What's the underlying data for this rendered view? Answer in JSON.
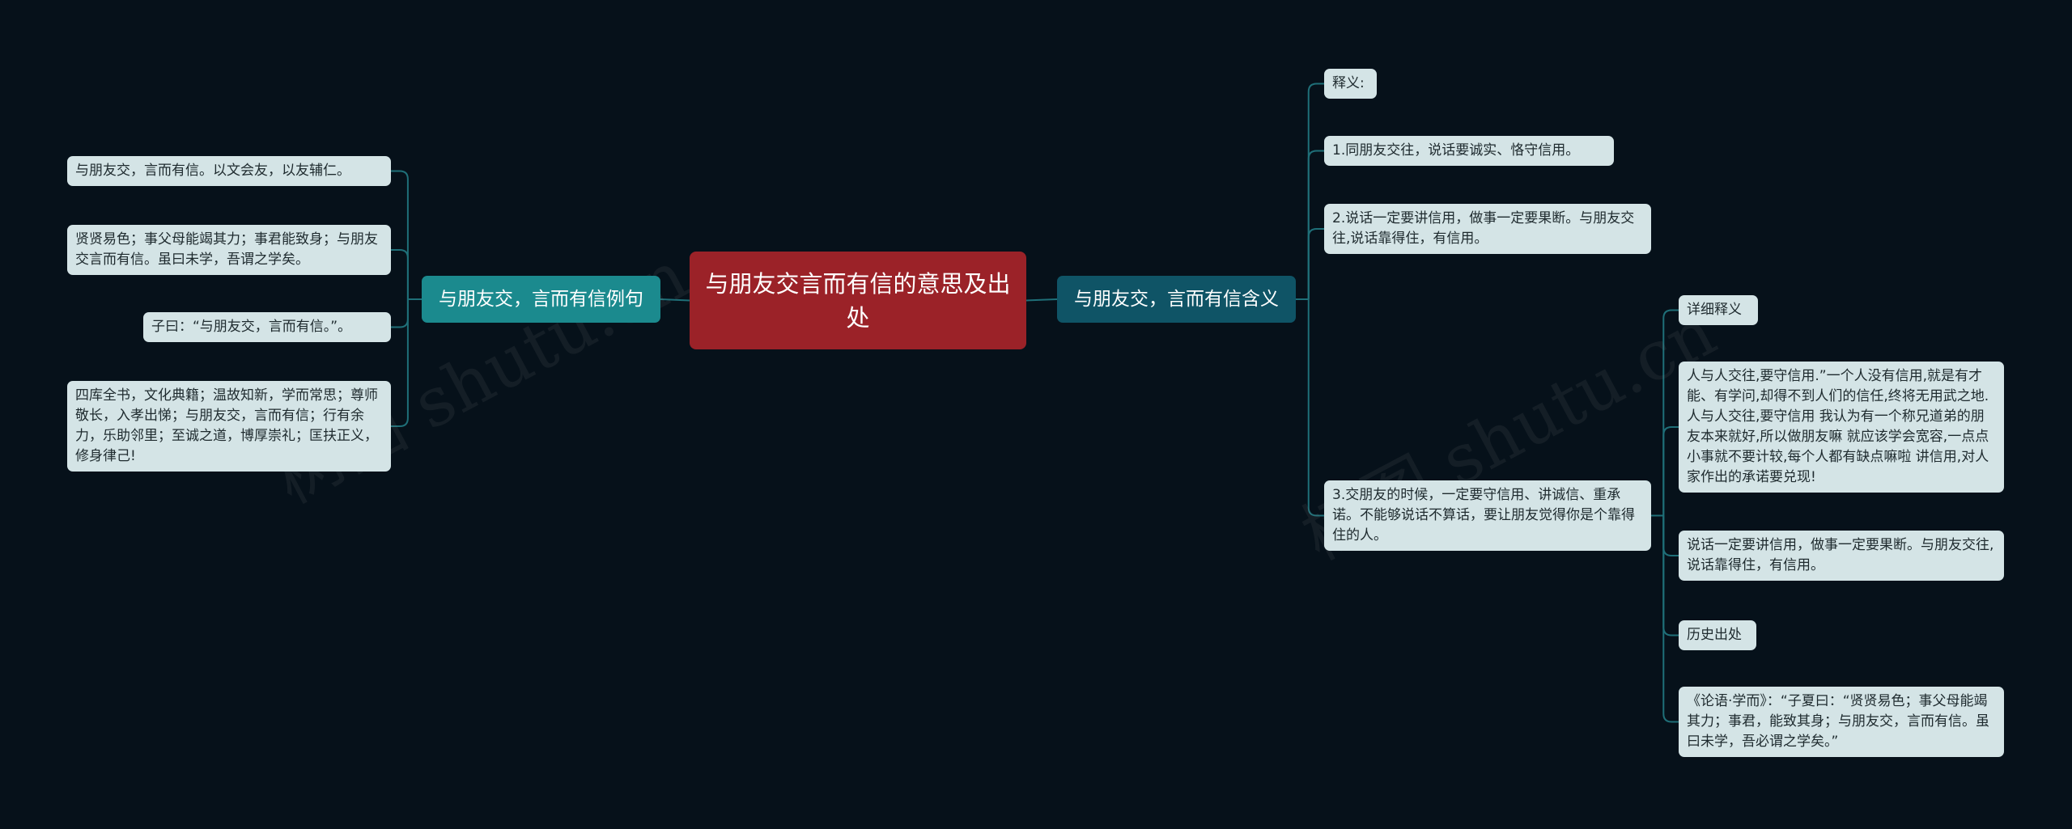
{
  "root": {
    "title": "与朋友交言而有信的意思及出处"
  },
  "left_branch": {
    "label": "与朋友交，言而有信例句",
    "items": [
      "与朋友交，言而有信。以文会友，以友辅仁。",
      "贤贤易色；事父母能竭其力；事君能致身；与朋友交言而有信。虽曰未学，吾谓之学矣。",
      "子曰：“与朋友交，言而有信。”。",
      "四库全书，文化典籍；温故知新，学而常思；尊师敬长，入孝出悌；与朋友交，言而有信；行有余力，乐助邻里；至诚之道，博厚崇礼；匡扶正义，修身律己!"
    ]
  },
  "right_branch": {
    "label": "与朋友交，言而有信含义",
    "items": [
      "释义:",
      "1.同朋友交往，说话要诚实、恪守信用。",
      "2.说话一定要讲信用，做事一定要果断。与朋友交往,说话靠得住，有信用。",
      "3.交朋友的时候，一定要守信用、讲诚信、重承诺。不能够说话不算话，要让朋友觉得你是个靠得住的人。"
    ],
    "sub_items": [
      "详细释义",
      "人与人交往,要守信用.”一个人没有信用,就是有才能、有学问,却得不到人们的信任,终将无用武之地.人与人交往,要守信用  我认为有一个称兄道弟的朋友本来就好,所以做朋友嘛  就应该学会宽容,一点点小事就不要计较,每个人都有缺点嘛啦  讲信用,对人家作出的承诺要兑现!",
      "说话一定要讲信用，做事一定要果断。与朋友交往,说话靠得住，有信用。",
      "历史出处",
      "《论语·学而》：“子夏曰：“贤贤易色；事父母能竭其力；事君，能致其身；与朋友交，言而有信。虽曰未学，吾必谓之学矣。”"
    ]
  },
  "watermark": {
    "text": "树图 shutu.cn"
  },
  "colors": {
    "background": "#06111a",
    "root": "#9b2228",
    "left_branch": "#1b8a8e",
    "right_branch": "#0f5466",
    "leaf": "#d4e4e6",
    "link": "#1f6f78"
  }
}
